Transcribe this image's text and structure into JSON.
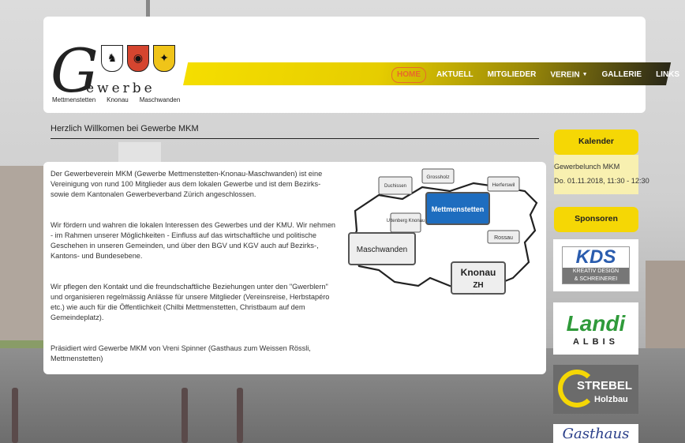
{
  "header": {
    "logo": {
      "letter": "G",
      "word": "ewerbe",
      "places": [
        "Mettmenstetten",
        "Knonau",
        "Maschwanden"
      ]
    }
  },
  "nav": {
    "items": [
      {
        "label": "HOME",
        "active": true
      },
      {
        "label": "AKTUELL"
      },
      {
        "label": "MITGLIEDER"
      },
      {
        "label": "VEREIN"
      },
      {
        "label": "GALLERIE"
      },
      {
        "label": "LINKS"
      }
    ]
  },
  "main": {
    "title": "Herzlich Willkomen bei Gewerbe MKM",
    "paragraphs": [
      "Der Gewerbeverein MKM (Gewerbe Mettmenstetten-Knonau-Maschwanden) ist eine Vereinigung von rund 100 Mitglieder aus dem lokalen Gewerbe und ist dem Bezirks- sowie dem Kantonalen Gewerbeverband Zürich angeschlossen.",
      "Wir fördern und wahren die lokalen Interessen des Gewerbes und der KMU. Wir nehmen - im Rahmen unserer Möglichkeiten - Einfluss auf das wirtschaftliche und politische Geschehen in unseren Gemeinden, und über den BGV und KGV auch auf Bezirks-, Kantons- und Bundesebene.",
      "Wir pflegen den Kontakt und die freundschaftliche Beziehungen unter den \"Gwerblern\" und organisieren regelmässig Anlässe für unsere Mitglieder (Vereinsreise, Herbstapéro etc.) wie auch für die Öffentlichkeit (Chilbi Mettmenstetten, Christbaum auf dem Gemeindeplatz).",
      "Präsidiert wird Gewerbe MKM von Vreni Spinner (Gasthaus zum Weissen Rössli, Mettmenstetten)"
    ],
    "map": {
      "signs": [
        "Duchissen",
        "Grossholz",
        "Herferswil",
        "Uttenberg Knonau",
        "Mettmenstetten",
        "Rossau",
        "Maschwanden",
        "Knonau",
        "ZH"
      ]
    }
  },
  "sidebar": {
    "calendar": {
      "title": "Kalender",
      "event": "Gewerbelunch MKM",
      "date": "Do. 01.11.2018, 11:30 - 12:30"
    },
    "sponsors": {
      "title": "Sponsoren",
      "items": [
        {
          "name": "KDS",
          "tagline1": "KREATIV DESIGN",
          "tagline2": "& SCHREINEREI"
        },
        {
          "name": "Landi",
          "tagline1": "ALBIS"
        },
        {
          "name": "STREBEL",
          "tagline1": "Holzbau"
        },
        {
          "name": "Gasthaus"
        }
      ]
    }
  },
  "colors": {
    "accent": "#f5d705",
    "nav_active": "#e8692b"
  }
}
